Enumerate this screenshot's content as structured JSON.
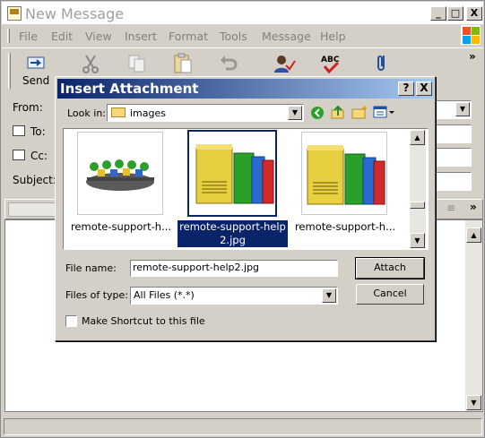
{
  "window": {
    "title": "New Message",
    "min_btn": "_",
    "max_btn": "□",
    "close_btn": "X"
  },
  "menu": [
    "File",
    "Edit",
    "View",
    "Insert",
    "Format",
    "Tools",
    "Message",
    "Help"
  ],
  "toolbar": {
    "send_label": "Send",
    "overflow": "»"
  },
  "fields": {
    "from_label": "From:",
    "to_label": "To:",
    "cc_label": "Cc:",
    "subject_label": "Subject:"
  },
  "format_overflow": "»",
  "dialog": {
    "title": "Insert Attachment",
    "help_btn": "?",
    "close_btn": "X",
    "look_in_label": "Look in:",
    "look_in_value": "images",
    "files": [
      {
        "name": "remote-support-h...",
        "selected": false
      },
      {
        "name_line1": "remote-support-help",
        "name_line2": "2.jpg",
        "selected": true
      },
      {
        "name": "remote-support-h...",
        "selected": false
      }
    ],
    "file_name_label": "File name:",
    "file_name_value": "remote-support-help2.jpg",
    "files_of_type_label": "Files of type:",
    "files_of_type_value": "All Files (*.*)",
    "attach_btn": "Attach",
    "cancel_btn": "Cancel",
    "shortcut_label": "Make Shortcut to this file"
  },
  "colors": {
    "title_active": "#0a246a",
    "selection": "#0a246a",
    "face": "#d4d0c8"
  }
}
